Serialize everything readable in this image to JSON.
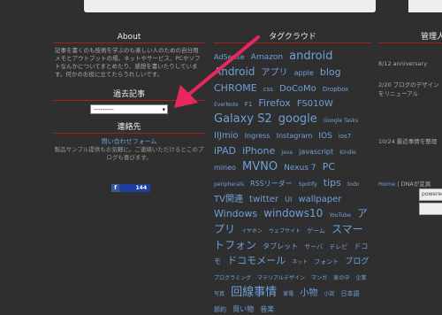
{
  "about": {
    "title": "About",
    "text": "記事を書くのも技術を学ぶのも楽しい人のための自分用メモとアウトプットの場。ネットやサービス、PCやソフトなんかについてまとめたり、感想を書いたりしています。何かのお役に立てたらうれしいです。"
  },
  "archive": {
    "title": "過去記事",
    "select_value": "---------"
  },
  "contact": {
    "title": "連絡先",
    "link": "問い合わせフォーム",
    "text": "製品サンプル提供もお気軽に。ご連絡いただけるとこのブログも喜びます。"
  },
  "counter": {
    "icon": "f",
    "count": "144"
  },
  "tags": {
    "title": "タグクラウド",
    "items": [
      {
        "t": "AdSense",
        "s": 8
      },
      {
        "t": "Amazon",
        "s": 9
      },
      {
        "t": "android",
        "s": 13
      },
      {
        "t": "Android",
        "s": 12
      },
      {
        "t": "アプリ",
        "s": 10
      },
      {
        "t": "apple",
        "s": 8
      },
      {
        "t": "blog",
        "s": 11
      },
      {
        "t": "CHROME",
        "s": 11
      },
      {
        "t": "css",
        "s": 7
      },
      {
        "t": "DoCoMo",
        "s": 10
      },
      {
        "t": "Dropbox",
        "s": 7
      },
      {
        "t": "EverNote",
        "s": 6
      },
      {
        "t": "F1",
        "s": 7
      },
      {
        "t": "Firefox",
        "s": 11
      },
      {
        "t": "FS010W",
        "s": 10
      },
      {
        "t": "Galaxy S2",
        "s": 13
      },
      {
        "t": "google",
        "s": 13
      },
      {
        "t": "Google Tasks",
        "s": 6
      },
      {
        "t": "IIJmio",
        "s": 10
      },
      {
        "t": "Ingress",
        "s": 8
      },
      {
        "t": "Instagram",
        "s": 8
      },
      {
        "t": "IOS",
        "s": 9
      },
      {
        "t": "ios7",
        "s": 7
      },
      {
        "t": "iPAD",
        "s": 11
      },
      {
        "t": "iPhone",
        "s": 11
      },
      {
        "t": "Java",
        "s": 6
      },
      {
        "t": "javascript",
        "s": 8
      },
      {
        "t": "Kindle",
        "s": 6
      },
      {
        "t": "mineo",
        "s": 8
      },
      {
        "t": "MVNO",
        "s": 13
      },
      {
        "t": "Nexus 7",
        "s": 9
      },
      {
        "t": "PC",
        "s": 11
      },
      {
        "t": "peripherals",
        "s": 6
      },
      {
        "t": "RSSリーダー",
        "s": 8
      },
      {
        "t": "Spotify",
        "s": 6
      },
      {
        "t": "tips",
        "s": 11
      },
      {
        "t": "todo",
        "s": 6
      },
      {
        "t": "TV関連",
        "s": 10
      },
      {
        "t": "twitter",
        "s": 10
      },
      {
        "t": "UI",
        "s": 8
      },
      {
        "t": "wallpaper",
        "s": 10
      },
      {
        "t": "Windows",
        "s": 11
      },
      {
        "t": "windows10",
        "s": 12
      },
      {
        "t": "YouTube",
        "s": 6
      },
      {
        "t": "アプリ",
        "s": 12
      },
      {
        "t": "イヤホン",
        "s": 6
      },
      {
        "t": "ウェブサイト",
        "s": 6
      },
      {
        "t": "ゲーム",
        "s": 7
      },
      {
        "t": "スマートフォン",
        "s": 12
      },
      {
        "t": "タブレット",
        "s": 8
      },
      {
        "t": "サーバ",
        "s": 7
      },
      {
        "t": "テレビ",
        "s": 7
      },
      {
        "t": "ドコモ",
        "s": 8
      },
      {
        "t": "ドコモメール",
        "s": 11
      },
      {
        "t": "ネット",
        "s": 6
      },
      {
        "t": "フォント",
        "s": 7
      },
      {
        "t": "ブログ",
        "s": 9
      },
      {
        "t": "プログラミング",
        "s": 6
      },
      {
        "t": "マテリアルデザイン",
        "s": 6
      },
      {
        "t": "マンガ",
        "s": 6
      },
      {
        "t": "家の中",
        "s": 6
      },
      {
        "t": "企業",
        "s": 6
      },
      {
        "t": "写真",
        "s": 6
      },
      {
        "t": "回線事情",
        "s": 13
      },
      {
        "t": "家電",
        "s": 6
      },
      {
        "t": "小物",
        "s": 10
      },
      {
        "t": "小説",
        "s": 6
      },
      {
        "t": "日本語",
        "s": 7
      },
      {
        "t": "節約",
        "s": 7
      },
      {
        "t": "買い物",
        "s": 8
      },
      {
        "t": "音楽",
        "s": 8
      }
    ]
  },
  "right": {
    "title": "管理人",
    "line1": "8/12 anniversary",
    "line2": "2/20 ブログのデザインをリニューアル",
    "line3": "10/24 最近事情を整理",
    "home": "Home",
    "sep": "|",
    "dna": "DNAが変異",
    "btn1": "powered",
    "btn2": ""
  },
  "colors": {
    "accent": "#e8275f",
    "tag_link": "#6fa0d8",
    "divider": "#a02323"
  }
}
